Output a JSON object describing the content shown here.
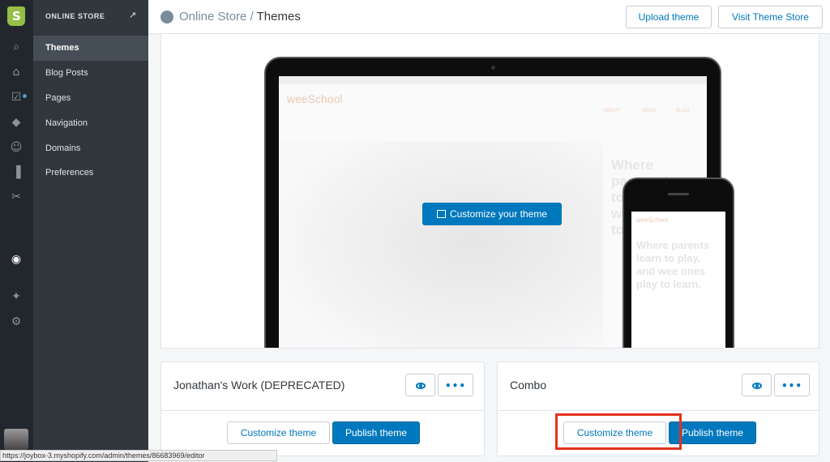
{
  "sidebar": {
    "header": "ONLINE STORE",
    "items": [
      {
        "label": "Themes"
      },
      {
        "label": "Blog Posts"
      },
      {
        "label": "Pages"
      },
      {
        "label": "Navigation"
      },
      {
        "label": "Domains"
      },
      {
        "label": "Preferences"
      }
    ]
  },
  "rail_icons": [
    "shopify-logo",
    "search-icon",
    "home-icon",
    "orders-icon",
    "products-icon",
    "customers-icon",
    "reports-icon",
    "discounts-icon",
    "online-store-icon",
    "apps-icon",
    "settings-icon"
  ],
  "header": {
    "breadcrumb_parent": "Online Store",
    "separator": "/",
    "breadcrumb_current": "Themes",
    "upload_label": "Upload theme",
    "visit_label": "Visit Theme Store"
  },
  "preview": {
    "customize_label": "Customize your theme",
    "site_brand": "weeSchool",
    "site_nav": [
      "ABOUT",
      "NEWS",
      "BLOG"
    ],
    "hero_text": "Where parents learn to play, and wee ones play to learn.",
    "phone_hero_text": "Where parents learn to play, and wee ones play to learn."
  },
  "themes": [
    {
      "name": "Jonathan's Work (DEPRECATED)",
      "customize_label": "Customize theme",
      "publish_label": "Publish theme"
    },
    {
      "name": "Combo",
      "customize_label": "Customize theme",
      "publish_label": "Publish theme"
    }
  ],
  "status_url": "https://joybox-3.myshopify.com/admin/themes/86683969/editor",
  "colors": {
    "accent": "#0078bd",
    "sidebar_bg": "#31373d",
    "rail_bg": "#22272d",
    "highlight": "#e3311f"
  }
}
